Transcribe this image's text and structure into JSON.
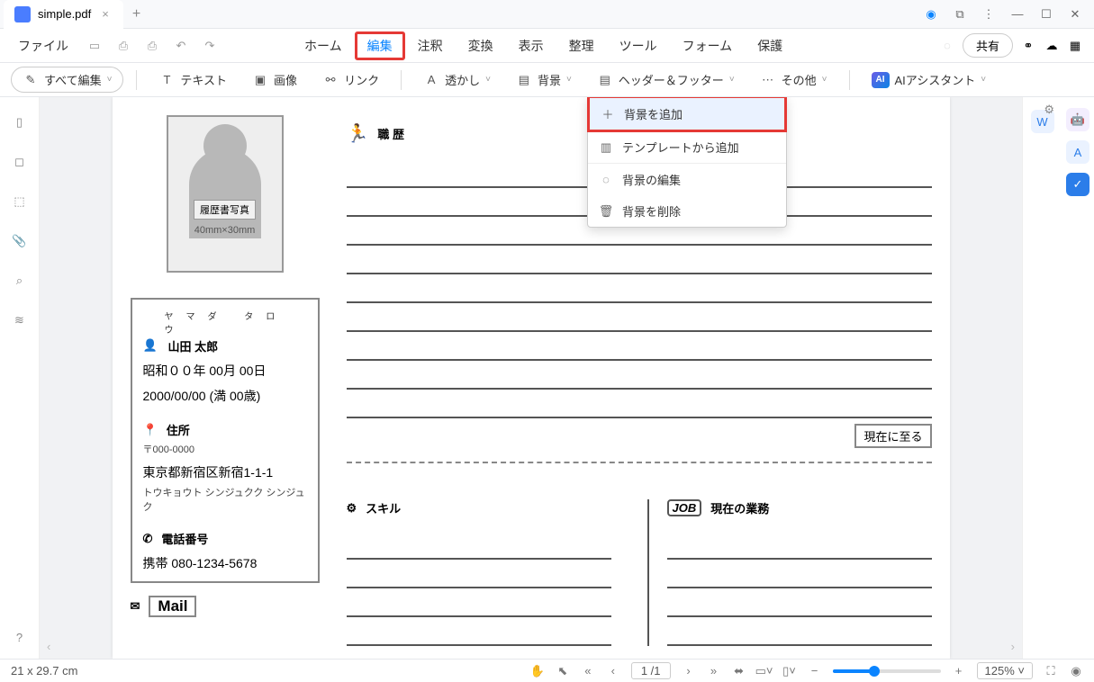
{
  "titlebar": {
    "tab_title": "simple.pdf"
  },
  "menubar": {
    "file": "ファイル",
    "tabs": [
      "ホーム",
      "編集",
      "注釈",
      "変換",
      "表示",
      "整理",
      "ツール",
      "フォーム",
      "保護"
    ],
    "active_index": 1,
    "share": "共有"
  },
  "toolbar": {
    "edit_all": "すべて編集",
    "text": "テキスト",
    "image": "画像",
    "link": "リンク",
    "watermark": "透かし",
    "background": "背景",
    "header_footer": "ヘッダー＆フッター",
    "other": "その他",
    "ai": "AIアシスタント",
    "ai_badge": "AI"
  },
  "dropdown": {
    "add": "背景を追加",
    "from_template": "テンプレートから追加",
    "edit": "背景の編集",
    "delete": "背景を削除"
  },
  "doc": {
    "photo_label": "履歴書写真",
    "photo_size": "40mm×30mm",
    "furigana": "ヤマダ タロウ",
    "name": "山田 太郎",
    "era_date": "昭和００年 00月 00日",
    "western_date": "2000/00/00 (満 00歳)",
    "address_head": "住所",
    "postal": "〒000-0000",
    "address": "東京都新宿区新宿1-1-1",
    "address_kana": "トウキョウト シンジュクク シンジュク",
    "phone_head": "電話番号",
    "phone": "携帯 080-1234-5678",
    "mail": "Mail",
    "career_head": "職 歴",
    "present": "現在に至る",
    "skill_head": "スキル",
    "job_badge": "JOB",
    "current_work": "現在の業務"
  },
  "statusbar": {
    "dims": "21 x 29.7 cm",
    "page": "1 /1",
    "zoom": "125%"
  }
}
